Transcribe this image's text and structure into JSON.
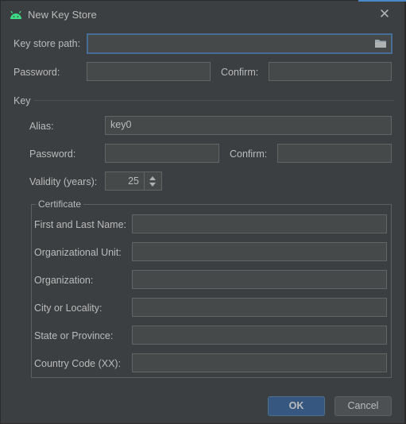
{
  "window": {
    "title": "New Key Store",
    "icon": "android-icon",
    "close_glyph": "✕"
  },
  "keystore": {
    "path_label": "Key store path:",
    "path_value": "",
    "password_label": "Password:",
    "confirm_label": "Confirm:"
  },
  "key": {
    "section_label": "Key",
    "alias_label": "Alias:",
    "alias_value": "key0",
    "password_label": "Password:",
    "confirm_label": "Confirm:",
    "validity_label": "Validity (years):",
    "validity_value": "25"
  },
  "certificate": {
    "legend": "Certificate",
    "fields": [
      {
        "label": "First and Last Name:",
        "value": ""
      },
      {
        "label": "Organizational Unit:",
        "value": ""
      },
      {
        "label": "Organization:",
        "value": ""
      },
      {
        "label": "City or Locality:",
        "value": ""
      },
      {
        "label": "State or Province:",
        "value": ""
      },
      {
        "label": "Country Code (XX):",
        "value": ""
      }
    ]
  },
  "buttons": {
    "ok": "OK",
    "cancel": "Cancel"
  },
  "colors": {
    "background": "#3c3f41",
    "field": "#45494a",
    "focus_border": "#466d94",
    "ok_button": "#365880",
    "android_green": "#3ddc84"
  }
}
